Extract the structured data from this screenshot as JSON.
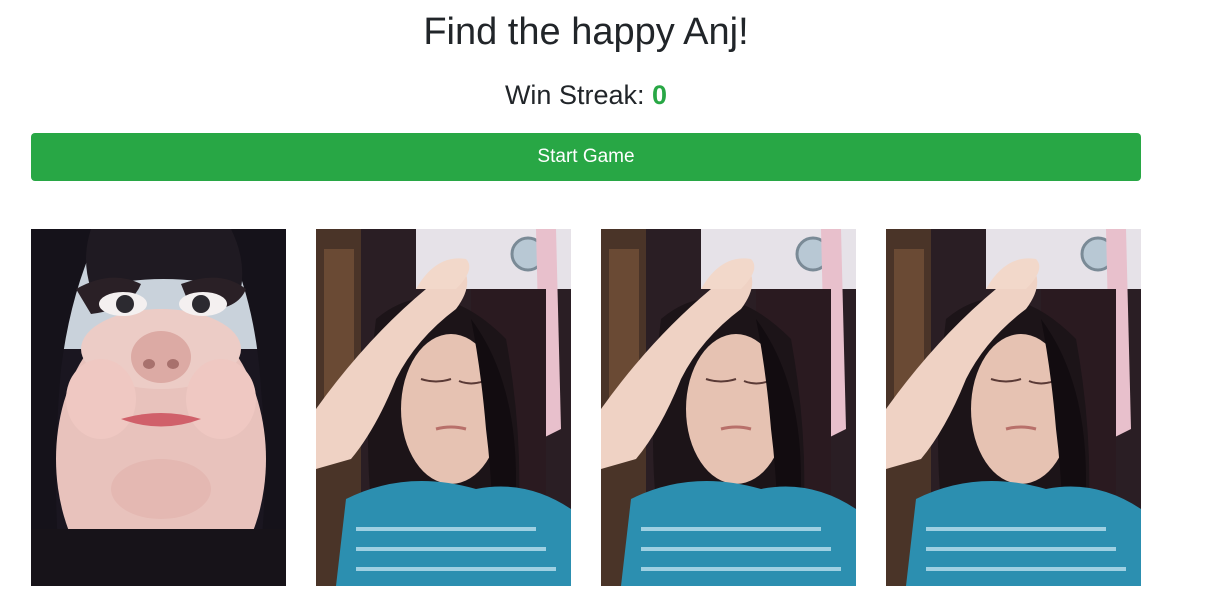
{
  "header": {
    "title": "Find the happy Anj!",
    "streak_label": "Win Streak:",
    "streak_value": "0"
  },
  "controls": {
    "start_label": "Start Game"
  },
  "colors": {
    "accent": "#28a745",
    "text": "#212529"
  },
  "cards": [
    {
      "id": "card-1",
      "face": "happy-face-photo"
    },
    {
      "id": "card-2",
      "face": "sad-face-photo"
    },
    {
      "id": "card-3",
      "face": "sad-face-photo"
    },
    {
      "id": "card-4",
      "face": "sad-face-photo"
    }
  ]
}
